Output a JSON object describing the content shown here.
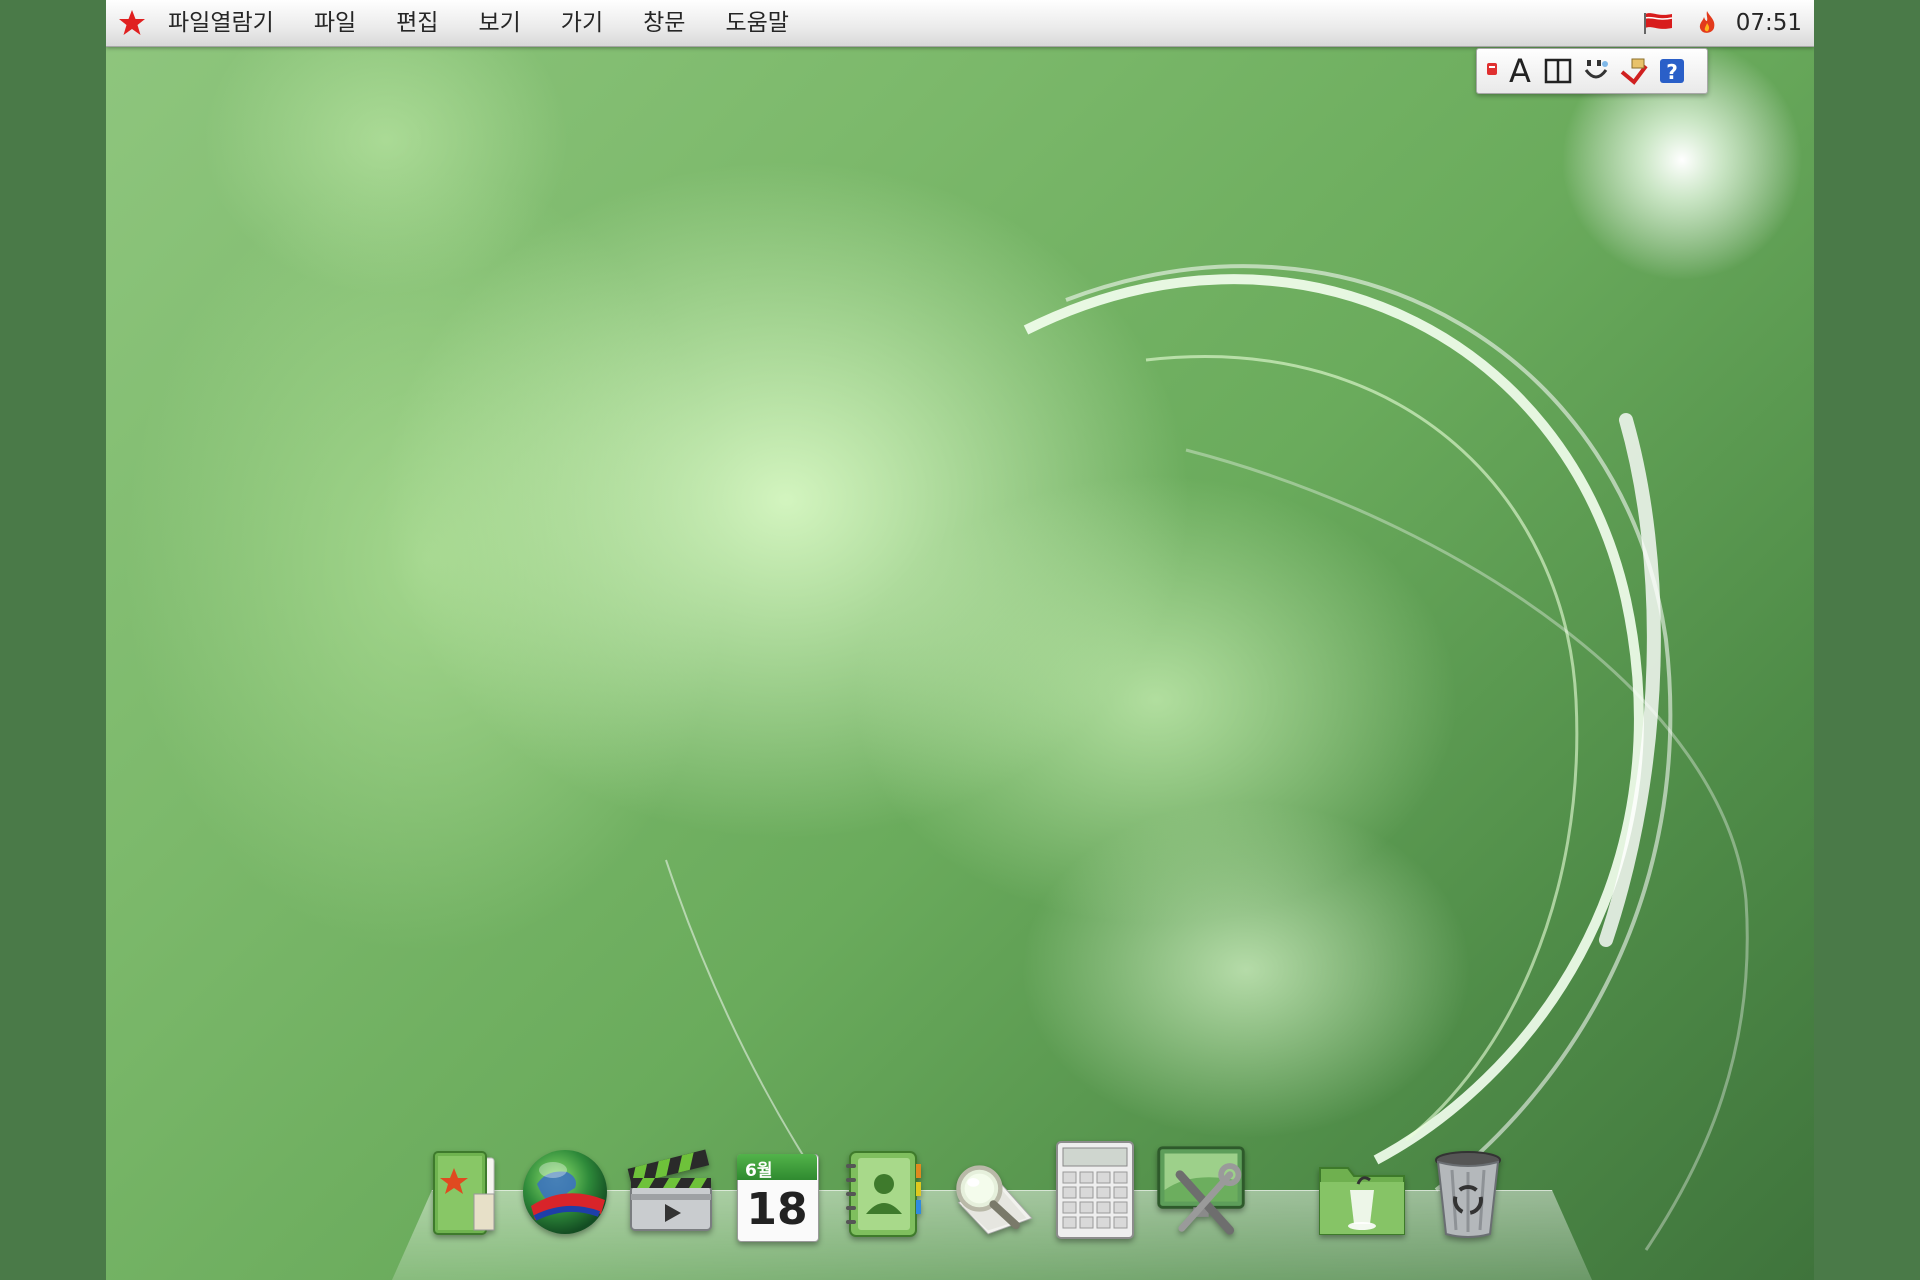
{
  "menubar": {
    "app_name": "파일열람기",
    "items": [
      "파일",
      "편집",
      "보기",
      "가기",
      "창문",
      "도움말"
    ],
    "clock": "07:51"
  },
  "imebar": {
    "letter": "A"
  },
  "dock": {
    "calendar_month": "6월",
    "calendar_day": "18"
  },
  "colors": {
    "menubar_bg": "#e9e9e9",
    "accent_red": "#e02020",
    "desktop_green": "#7cb96b"
  }
}
